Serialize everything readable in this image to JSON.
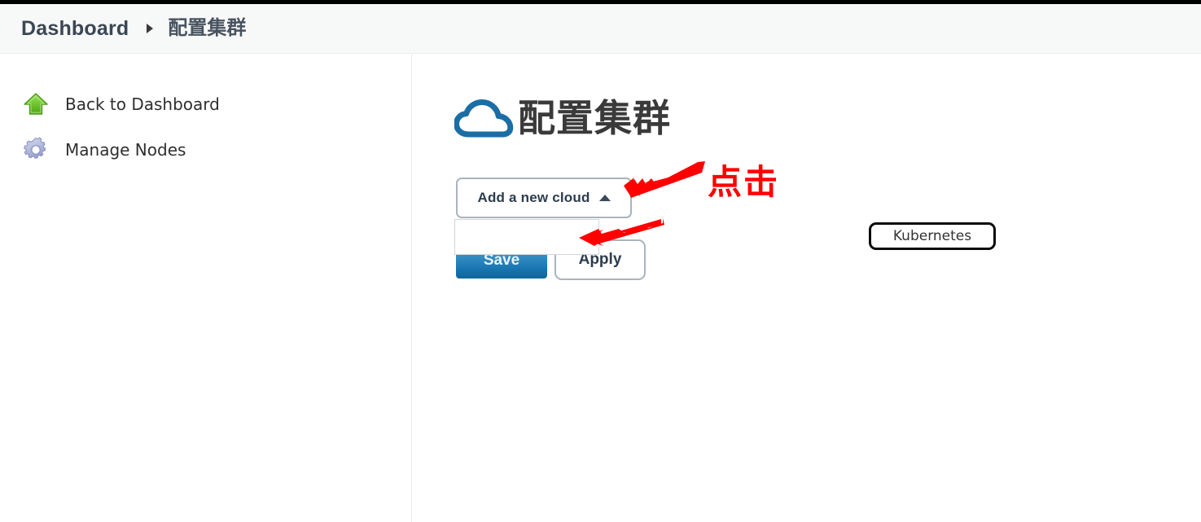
{
  "header": {
    "breadcrumb_root": "Dashboard",
    "breadcrumb_separator_icon": "chevron-right-icon",
    "breadcrumb_current": "配置集群"
  },
  "sidebar": {
    "items": [
      {
        "label": "Back to Dashboard",
        "icon": "green-up-arrow-icon"
      },
      {
        "label": "Manage Nodes",
        "icon": "gear-icon"
      }
    ]
  },
  "main": {
    "page_icon": "cloud-icon",
    "page_title": "配置集群",
    "dropdown": {
      "trigger_label": "Add a new cloud",
      "caret_icon": "caret-up-icon",
      "expanded": true,
      "options": [
        {
          "label": "Kubernetes",
          "highlighted": true
        }
      ]
    },
    "buttons": {
      "save_label": "Save",
      "apply_label": "Apply"
    }
  },
  "annotations": {
    "callout_text": "点击",
    "arrows": [
      {
        "name": "arrow-to-dropdown-trigger",
        "icon": "red-arrow-icon"
      },
      {
        "name": "arrow-to-kubernetes-option",
        "icon": "red-arrow-icon"
      }
    ]
  },
  "colors": {
    "accent_blue": "#1874ae",
    "annotation_red": "#ff0000",
    "title_dark": "#3a3a3a",
    "cloud_blue": "#1b6ea5",
    "icon_green": "#5bb82a",
    "border_gray": "#aab4bd"
  }
}
